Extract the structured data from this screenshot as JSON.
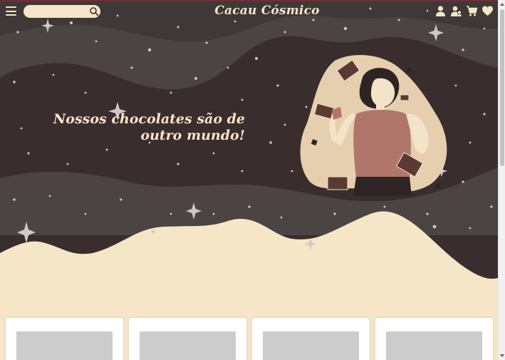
{
  "header": {
    "brand": "Cacau Cósmico",
    "search": {
      "value": "",
      "placeholder": ""
    },
    "icons": [
      "menu-icon",
      "search-icon",
      "user-icon",
      "users-icon",
      "cart-icon",
      "heart-icon"
    ]
  },
  "hero": {
    "tagline_line1": "Nossos chocolates são de",
    "tagline_line2": "outro mundo!"
  },
  "products": [
    {
      "image": "placeholder"
    },
    {
      "image": "placeholder"
    },
    {
      "image": "placeholder"
    },
    {
      "image": "placeholder"
    }
  ],
  "colors": {
    "cream": "#f5e6c8",
    "dark_brown": "#3a2c2c",
    "mid_gray": "#4a4442",
    "accent_red": "#7a2a33",
    "placeholder_gray": "#cccccc"
  }
}
